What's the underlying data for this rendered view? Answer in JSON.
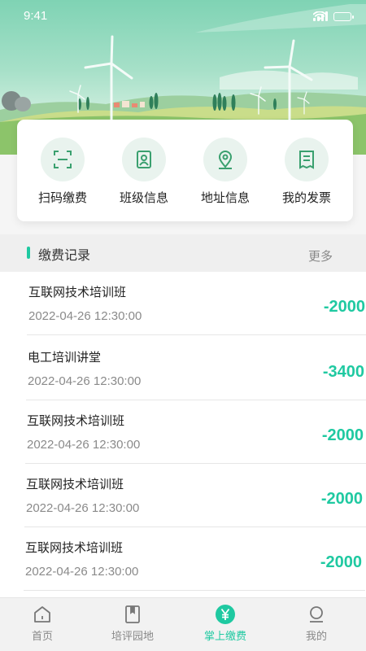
{
  "status_bar": {
    "time": "9:41"
  },
  "quick_actions": [
    {
      "label": "扫码缴费",
      "icon": "scan-icon"
    },
    {
      "label": "班级信息",
      "icon": "class-card-icon"
    },
    {
      "label": "地址信息",
      "icon": "location-pin-icon"
    },
    {
      "label": "我的发票",
      "icon": "invoice-icon"
    }
  ],
  "records": {
    "title": "缴费记录",
    "more_label": "更多",
    "items": [
      {
        "name": "互联网技术培训班",
        "time": "2022-04-26  12:30:00",
        "amount": "-2000"
      },
      {
        "name": "电工培训讲堂",
        "time": "2022-04-26  12:30:00",
        "amount": "-3400"
      },
      {
        "name": "互联网技术培训班",
        "time": "2022-04-26  12:30:00",
        "amount": "-2000"
      },
      {
        "name": "互联网技术培训班",
        "time": "2022-04-26  12:30:00",
        "amount": "-2000"
      },
      {
        "name": "互联网技术培训班",
        "time": "2022-04-26  12:30:00",
        "amount": "-2000"
      }
    ]
  },
  "tabbar": {
    "active": "掌上缴费",
    "tabs": [
      {
        "label": "首页",
        "icon": "home-icon"
      },
      {
        "label": "培评园地",
        "icon": "book-icon"
      },
      {
        "label": "掌上缴费",
        "icon": "yuan-icon"
      },
      {
        "label": "我的",
        "icon": "user-icon"
      }
    ]
  },
  "colors": {
    "accent": "#1fc9a1",
    "icon_green": "#3aa06f",
    "icon_bg": "#e9f3ee"
  }
}
